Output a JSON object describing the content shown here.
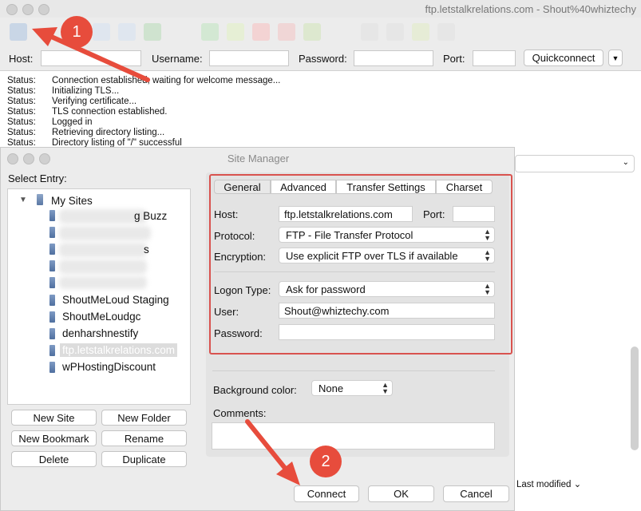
{
  "window": {
    "title": "ftp.letstalkrelations.com - Shout%40whiztechy"
  },
  "quickconnect": {
    "host_label": "Host:",
    "username_label": "Username:",
    "password_label": "Password:",
    "port_label": "Port:",
    "button": "Quickconnect",
    "dropdown": "▼"
  },
  "log": {
    "rows": [
      {
        "key": "Status:",
        "msg": "Connection established, waiting for welcome message..."
      },
      {
        "key": "Status:",
        "msg": "Initializing TLS..."
      },
      {
        "key": "Status:",
        "msg": "Verifying certificate..."
      },
      {
        "key": "Status:",
        "msg": "TLS connection established."
      },
      {
        "key": "Status:",
        "msg": "Logged in"
      },
      {
        "key": "Status:",
        "msg": "Retrieving directory listing..."
      },
      {
        "key": "Status:",
        "msg": "Directory listing of \"/\" successful"
      }
    ]
  },
  "right_pane": {
    "last_modified": "Last modified"
  },
  "site_manager": {
    "title": "Site Manager",
    "select_entry": "Select Entry:",
    "root": "My Sites",
    "sites": [
      "g Buzz",
      "s",
      "",
      "",
      "ShoutMeLoud Staging",
      "ShoutMeLoudgc",
      "denharshnestify",
      "ftp.letstalkrelations.com",
      "wPHostingDiscount"
    ],
    "buttons": {
      "new_site": "New Site",
      "new_folder": "New Folder",
      "new_bookmark": "New Bookmark",
      "rename": "Rename",
      "delete": "Delete",
      "duplicate": "Duplicate",
      "connect": "Connect",
      "ok": "OK",
      "cancel": "Cancel"
    },
    "tabs": [
      "General",
      "Advanced",
      "Transfer Settings",
      "Charset"
    ],
    "general": {
      "host_label": "Host:",
      "host_value": "ftp.letstalkrelations.com",
      "port_label": "Port:",
      "port_value": "",
      "protocol_label": "Protocol:",
      "protocol_value": "FTP - File Transfer Protocol",
      "encryption_label": "Encryption:",
      "encryption_value": "Use explicit FTP over TLS if available",
      "logon_label": "Logon Type:",
      "logon_value": "Ask for password",
      "user_label": "User:",
      "user_value": "Shout@whiztechy.com",
      "password_label": "Password:",
      "password_value": ""
    },
    "bg_color_label": "Background color:",
    "bg_color_value": "None",
    "comments_label": "Comments:"
  },
  "annotations": {
    "step1": "1",
    "step2": "2",
    "color": "#e74c3c"
  }
}
